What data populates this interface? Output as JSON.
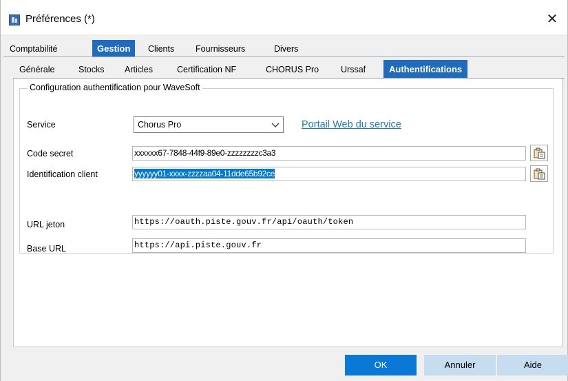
{
  "window": {
    "title": "Préférences (*)",
    "close_glyph": "✕"
  },
  "main_tabs": [
    {
      "label": "Comptabilité",
      "active": false
    },
    {
      "label": "Gestion",
      "active": true
    },
    {
      "label": "Clients",
      "active": false
    },
    {
      "label": "Fournisseurs",
      "active": false
    },
    {
      "label": "Divers",
      "active": false
    }
  ],
  "sub_tabs": [
    {
      "label": "Générale",
      "active": false
    },
    {
      "label": "Stocks",
      "active": false
    },
    {
      "label": "Articles",
      "active": false
    },
    {
      "label": "Certification NF",
      "active": false
    },
    {
      "label": "CHORUS Pro",
      "active": false
    },
    {
      "label": "Urssaf",
      "active": false
    },
    {
      "label": "Authentifications",
      "active": true
    }
  ],
  "group": {
    "title": "Configuration authentification pour WaveSoft",
    "service_label": "Service",
    "service_value": "Chorus Pro",
    "portal_link": "Portail Web du service",
    "code_secret_label": "Code secret",
    "code_secret_value": "xxxxxx67-7848-44f9-89e0-zzzzzzzzc3a3",
    "client_id_label": "Identification client",
    "client_id_value": "yyyyyy01-xxxx-zzzzaa04-11dde65b92ce",
    "url_jeton_label": "URL jeton",
    "url_jeton_value": "https://oauth.piste.gouv.fr/api/oauth/token",
    "base_url_label": "Base URL",
    "base_url_value": "https://api.piste.gouv.fr"
  },
  "buttons": {
    "ok": "OK",
    "cancel": "Annuler",
    "help": "Aide"
  },
  "colors": {
    "accent": "#1e6bbf",
    "ok_button": "#0a78d6",
    "secondary_button": "#c6dcef",
    "link": "#1a7ad1",
    "selection": "#0078d7"
  }
}
